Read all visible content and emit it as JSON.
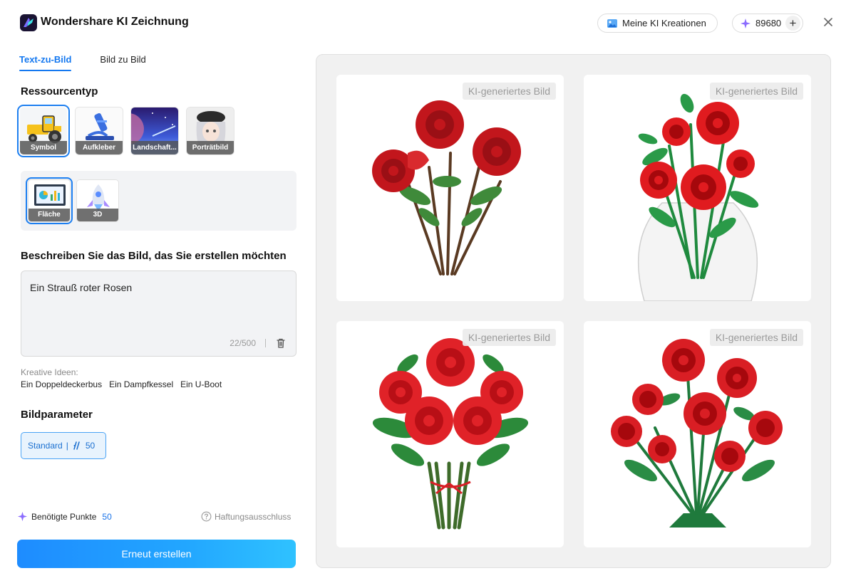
{
  "app": {
    "title": "Wondershare KI Zeichnung"
  },
  "header": {
    "creations_label": "Meine KI Kreationen",
    "points": "89680",
    "plus_label": "+"
  },
  "tabs": [
    {
      "label": "Text-zu-Bild",
      "active": true
    },
    {
      "label": "Bild zu Bild",
      "active": false
    }
  ],
  "resource": {
    "title": "Ressourcentyp",
    "types": [
      {
        "label": "Symbol",
        "icon": "tractor-icon",
        "selected": true
      },
      {
        "label": "Aufkleber",
        "icon": "microscope-icon",
        "selected": false
      },
      {
        "label": "Landschaft...",
        "icon": "landscape-icon",
        "selected": false
      },
      {
        "label": "Porträtbild",
        "icon": "portrait-icon",
        "selected": false
      }
    ],
    "subtypes": [
      {
        "label": "Fläche",
        "icon": "monitor-chart-icon",
        "selected": true
      },
      {
        "label": "3D",
        "icon": "rocket-icon",
        "selected": false
      }
    ]
  },
  "prompt": {
    "title": "Beschreiben Sie das Bild, das Sie erstellen möchten",
    "value": "Ein Strauß roter Rosen",
    "count": "22/500"
  },
  "ideas": {
    "label": "Kreative Ideen:",
    "items": [
      "Ein Doppeldeckerbus",
      "Ein Dampfkessel",
      "Ein U-Boot"
    ]
  },
  "params": {
    "title": "Bildparameter",
    "standard_label": "Standard",
    "separator": "|",
    "cost": "50"
  },
  "footer": {
    "points_label": "Benötigte Punkte",
    "points_value": "50",
    "disclaimer": "Haftungsausschluss",
    "cta": "Erneut erstellen"
  },
  "gallery": {
    "badge": "KI-generiertes Bild",
    "images": [
      {
        "name": "rose-bouquet-1"
      },
      {
        "name": "rose-bouquet-2"
      },
      {
        "name": "rose-bouquet-3"
      },
      {
        "name": "rose-bouquet-4"
      }
    ]
  },
  "colors": {
    "accent": "#1478f0",
    "rose": "#d81f26",
    "leaf": "#2f8a3c"
  }
}
